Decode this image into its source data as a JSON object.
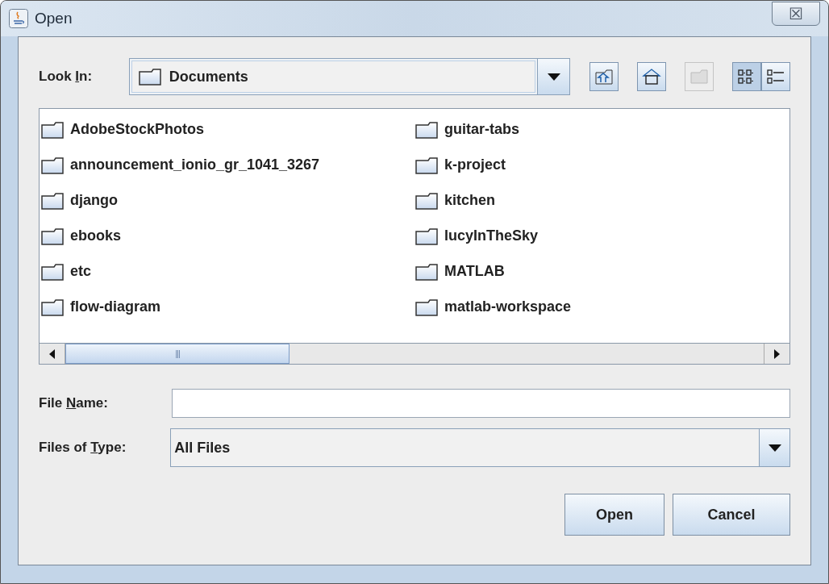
{
  "window": {
    "title": "Open",
    "close": "☒"
  },
  "look_in": {
    "label": [
      {
        "text": "Look ",
        "underlined": false
      },
      {
        "text": "I",
        "underlined": true
      },
      {
        "text": "n:",
        "underlined": false
      }
    ],
    "value": "Documents"
  },
  "toolbar": [
    {
      "kind": "up",
      "disabled": false
    },
    {
      "kind": "home",
      "disabled": false
    },
    {
      "kind": "new-folder",
      "disabled": true
    },
    {
      "kind": "list",
      "disabled": false,
      "selected": true
    },
    {
      "kind": "details",
      "disabled": false,
      "selected": false
    }
  ],
  "files": {
    "columns": [
      [
        "AdobeStockPhotos",
        "announcement_ionio_gr_1041_3267",
        "django",
        "ebooks",
        "etc",
        "flow-diagram"
      ],
      [
        "guitar-tabs",
        "k-project",
        "kitchen",
        "lucyInTheSky",
        "MATLAB",
        "matlab-workspace"
      ]
    ]
  },
  "scrollbar": {
    "thumb_grip": "|||"
  },
  "file_name": {
    "label": [
      {
        "text": "File ",
        "underlined": false
      },
      {
        "text": "N",
        "underlined": true
      },
      {
        "text": "ame:",
        "underlined": false
      }
    ]
  },
  "files_of_type": {
    "label": [
      {
        "text": "Files of ",
        "underlined": false
      },
      {
        "text": "T",
        "underlined": true
      },
      {
        "text": "ype:",
        "underlined": false
      }
    ],
    "value": "All Files"
  },
  "buttons": [
    "Open",
    "Cancel"
  ]
}
